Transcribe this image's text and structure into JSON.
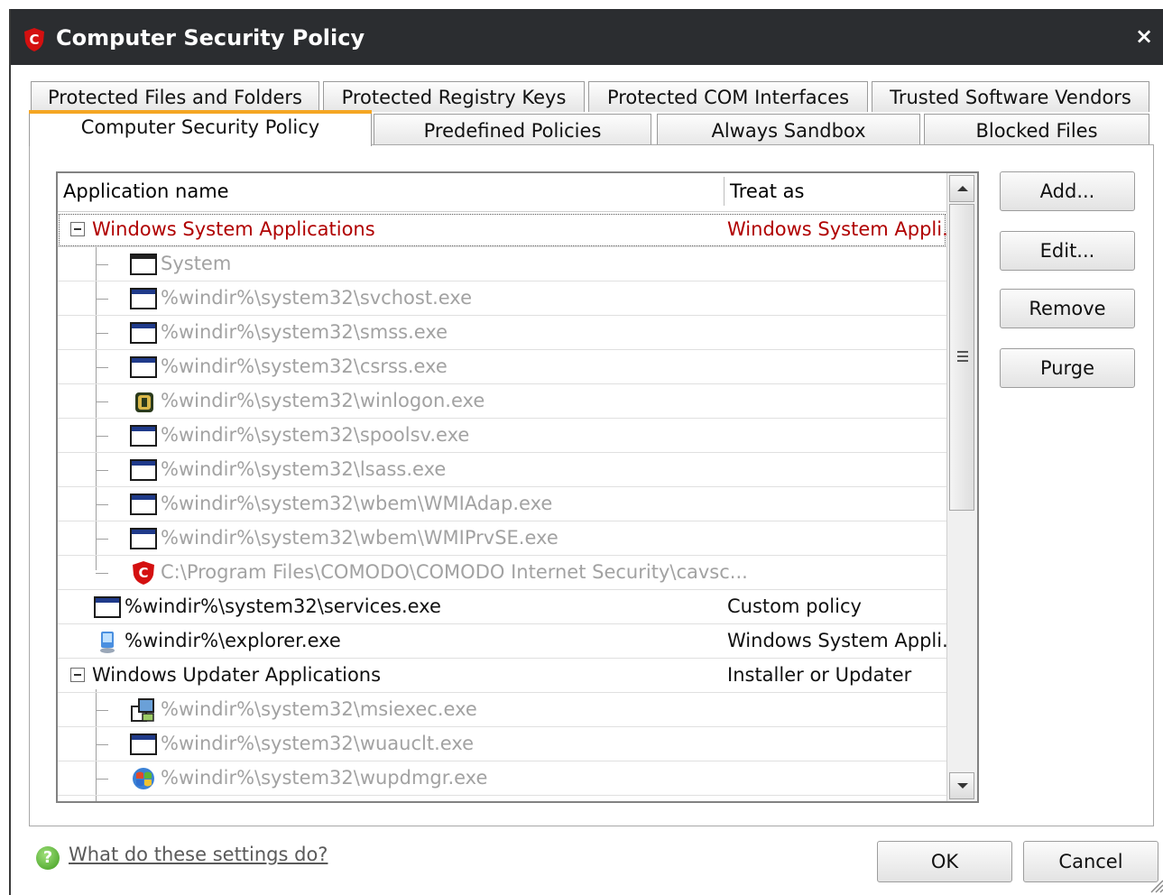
{
  "window": {
    "title": "Computer Security Policy",
    "close_glyph": "×"
  },
  "tabs_row1": [
    {
      "label": "Protected Files and Folders"
    },
    {
      "label": "Protected Registry Keys"
    },
    {
      "label": "Protected COM Interfaces"
    },
    {
      "label": "Trusted Software Vendors"
    }
  ],
  "tabs_row2": [
    {
      "label": "Computer Security Policy",
      "active": true
    },
    {
      "label": "Predefined Policies"
    },
    {
      "label": "Always Sandbox"
    },
    {
      "label": "Blocked Files"
    }
  ],
  "table": {
    "columns": [
      "Application name",
      "Treat as"
    ],
    "rows": [
      {
        "name": "Windows System Applications",
        "treat": "Windows System Appli...",
        "type": "group",
        "color": "#b00000",
        "selected": true
      },
      {
        "name": "System",
        "treat": "",
        "type": "child",
        "icon": "system-window-icon"
      },
      {
        "name": "%windir%\\system32\\svchost.exe",
        "treat": "",
        "type": "child",
        "icon": "app-window-icon"
      },
      {
        "name": "%windir%\\system32\\smss.exe",
        "treat": "",
        "type": "child",
        "icon": "app-window-icon"
      },
      {
        "name": "%windir%\\system32\\csrss.exe",
        "treat": "",
        "type": "child",
        "icon": "app-window-icon"
      },
      {
        "name": "%windir%\\system32\\winlogon.exe",
        "treat": "",
        "type": "child",
        "icon": "winlogon-icon"
      },
      {
        "name": "%windir%\\system32\\spoolsv.exe",
        "treat": "",
        "type": "child",
        "icon": "app-window-icon"
      },
      {
        "name": "%windir%\\system32\\lsass.exe",
        "treat": "",
        "type": "child",
        "icon": "app-window-icon"
      },
      {
        "name": "%windir%\\system32\\wbem\\WMIAdap.exe",
        "treat": "",
        "type": "child",
        "icon": "app-window-icon"
      },
      {
        "name": "%windir%\\system32\\wbem\\WMIPrvSE.exe",
        "treat": "",
        "type": "child",
        "icon": "app-window-icon"
      },
      {
        "name": "C:\\Program Files\\COMODO\\COMODO Internet Security\\cavsc...",
        "treat": "",
        "type": "child-last",
        "icon": "comodo-shield-icon"
      },
      {
        "name": "%windir%\\system32\\services.exe",
        "treat": "Custom policy",
        "type": "item",
        "icon": "app-window-icon"
      },
      {
        "name": "%windir%\\explorer.exe",
        "treat": "Windows System Appli...",
        "type": "item",
        "icon": "explorer-icon"
      },
      {
        "name": "Windows Updater Applications",
        "treat": "Installer or Updater",
        "type": "group"
      },
      {
        "name": "%windir%\\system32\\msiexec.exe",
        "treat": "",
        "type": "child",
        "icon": "installer-icon"
      },
      {
        "name": "%windir%\\system32\\wuauclt.exe",
        "treat": "",
        "type": "child",
        "icon": "app-window-icon"
      },
      {
        "name": "%windir%\\system32\\wupdmgr.exe",
        "treat": "",
        "type": "child",
        "icon": "windows-update-icon"
      }
    ]
  },
  "side_buttons": {
    "add": "Add...",
    "edit": "Edit...",
    "remove": "Remove",
    "purge": "Purge"
  },
  "footer": {
    "help_link": "What do these settings do?",
    "help_glyph": "?",
    "ok": "OK",
    "cancel": "Cancel"
  }
}
